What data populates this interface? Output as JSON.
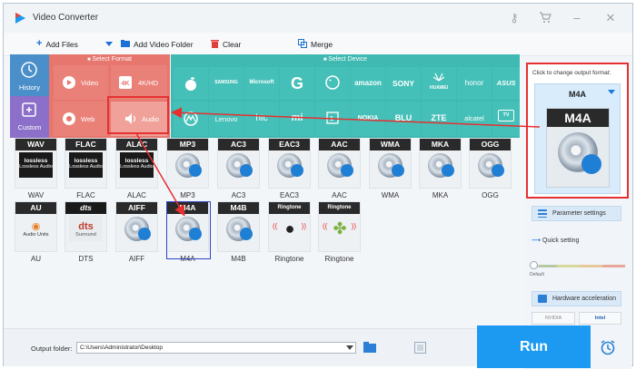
{
  "app": {
    "title": "Video Converter"
  },
  "titlebar": {
    "icons": [
      "key-icon",
      "cart-icon",
      "minimize-icon",
      "close-icon"
    ]
  },
  "toolbar": {
    "add_files": "Add Files",
    "add_video_folder": "Add Video Folder",
    "clear": "Clear",
    "merge": "Merge"
  },
  "format_panel": {
    "select_format_label": "Select Format",
    "select_device_label": "Select Device",
    "history": "History",
    "custom": "Custom",
    "video": "Video",
    "hd": "4K/HD",
    "web": "Web",
    "audio": "Audio",
    "brands_row1": [
      "SAMSUNG",
      "Microsoft",
      "amazon",
      "SONY",
      "HUAWEI",
      "honor",
      "ASUS"
    ],
    "brands_row2": [
      "Lenovo",
      "htc",
      "mi",
      "NOKIA",
      "BLU",
      "ZTE",
      "alcatel",
      "TV"
    ]
  },
  "formats": {
    "row1": [
      {
        "code": "WAV",
        "name": "WAV",
        "style": "lossless"
      },
      {
        "code": "FLAC",
        "name": "FLAC",
        "style": "lossless"
      },
      {
        "code": "ALAC",
        "name": "ALAC",
        "style": "lossless"
      },
      {
        "code": "MP3",
        "name": "MP3",
        "style": "disc"
      },
      {
        "code": "AC3",
        "name": "AC3",
        "style": "disc"
      },
      {
        "code": "EAC3",
        "name": "EAC3",
        "style": "disc"
      },
      {
        "code": "AAC",
        "name": "AAC",
        "style": "disc"
      },
      {
        "code": "WMA",
        "name": "WMA",
        "style": "disc"
      },
      {
        "code": "MKA",
        "name": "MKA",
        "style": "disc"
      },
      {
        "code": "OGG",
        "name": "OGG",
        "style": "disc"
      }
    ],
    "row2": [
      {
        "code": "AU",
        "name": "AU",
        "style": "au"
      },
      {
        "code": "dts",
        "name": "DTS",
        "style": "dts"
      },
      {
        "code": "AIFF",
        "name": "AIFF",
        "style": "disc"
      },
      {
        "code": "M4A",
        "name": "M4A",
        "style": "disc"
      },
      {
        "code": "M4B",
        "name": "M4B",
        "style": "disc"
      },
      {
        "code": "Ringtone",
        "name": "Ringtone",
        "style": "apple"
      },
      {
        "code": "Ringtone",
        "name": "Ringtone",
        "style": "android"
      }
    ],
    "lossless_badge": "lossless",
    "lossless_sub": "Lossless Audio",
    "au_sub": "Audio Units",
    "dts_sub": "Surround"
  },
  "output": {
    "hint": "Click to change output format:",
    "selected": "M4A",
    "parameter_settings": "Parameter settings",
    "quick_setting": "Quick setting",
    "default_label": "Default",
    "hardware_acceleration": "Hardware acceleration",
    "nvidia": "NVIDIA",
    "intel": "Intel"
  },
  "bottom": {
    "output_folder_label": "Output folder:",
    "output_folder_value": "C:\\Users\\Administrator\\Desktop",
    "run": "Run"
  },
  "colors": {
    "accent": "#1c9af2",
    "format_tiles": "#e87a72",
    "device_tiles": "#3fb9b1",
    "highlight": "#e53030",
    "selection": "#2d43c9"
  }
}
